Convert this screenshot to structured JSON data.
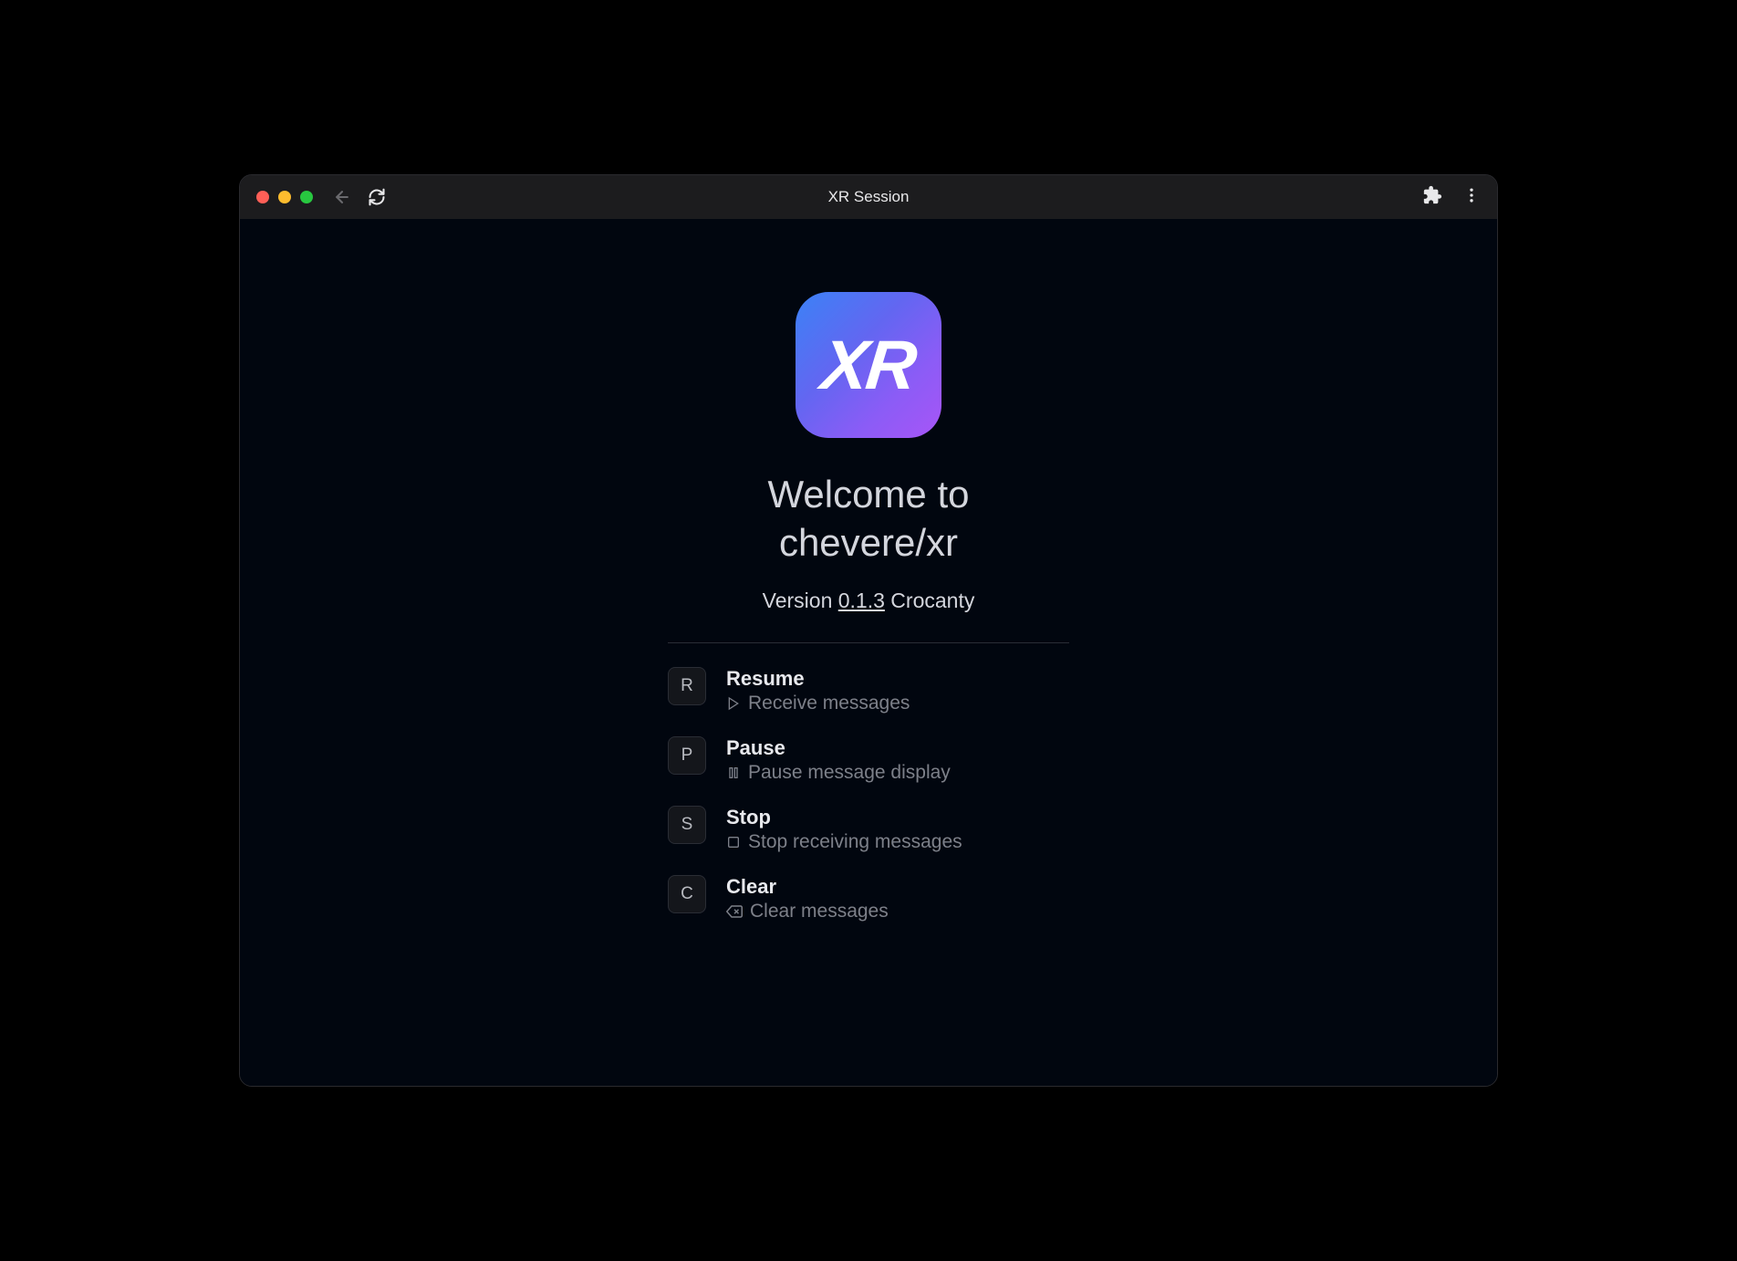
{
  "window": {
    "title": "XR Session"
  },
  "logo": {
    "text": "XR"
  },
  "heading": {
    "line1": "Welcome to",
    "line2": "chevere/xr"
  },
  "version": {
    "prefix": "Version ",
    "number": "0.1.3",
    "codename": " Crocanty"
  },
  "shortcuts": [
    {
      "key": "R",
      "title": "Resume",
      "icon": "play",
      "desc": "Receive messages"
    },
    {
      "key": "P",
      "title": "Pause",
      "icon": "pause",
      "desc": "Pause message display"
    },
    {
      "key": "S",
      "title": "Stop",
      "icon": "stop",
      "desc": "Stop receiving messages"
    },
    {
      "key": "C",
      "title": "Clear",
      "icon": "clear",
      "desc": "Clear messages"
    }
  ]
}
